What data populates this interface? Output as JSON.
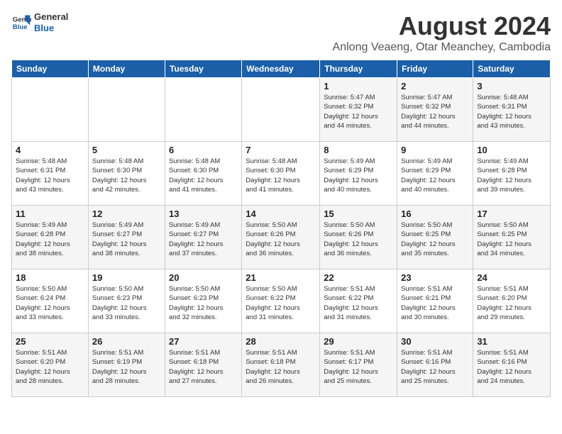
{
  "logo": {
    "line1": "General",
    "line2": "Blue"
  },
  "title": "August 2024",
  "subtitle": "Anlong Veaeng, Otar Meanchey, Cambodia",
  "headers": [
    "Sunday",
    "Monday",
    "Tuesday",
    "Wednesday",
    "Thursday",
    "Friday",
    "Saturday"
  ],
  "weeks": [
    [
      {
        "day": "",
        "info": ""
      },
      {
        "day": "",
        "info": ""
      },
      {
        "day": "",
        "info": ""
      },
      {
        "day": "",
        "info": ""
      },
      {
        "day": "1",
        "info": "Sunrise: 5:47 AM\nSunset: 6:32 PM\nDaylight: 12 hours\nand 44 minutes."
      },
      {
        "day": "2",
        "info": "Sunrise: 5:47 AM\nSunset: 6:32 PM\nDaylight: 12 hours\nand 44 minutes."
      },
      {
        "day": "3",
        "info": "Sunrise: 5:48 AM\nSunset: 6:31 PM\nDaylight: 12 hours\nand 43 minutes."
      }
    ],
    [
      {
        "day": "4",
        "info": "Sunrise: 5:48 AM\nSunset: 6:31 PM\nDaylight: 12 hours\nand 43 minutes."
      },
      {
        "day": "5",
        "info": "Sunrise: 5:48 AM\nSunset: 6:30 PM\nDaylight: 12 hours\nand 42 minutes."
      },
      {
        "day": "6",
        "info": "Sunrise: 5:48 AM\nSunset: 6:30 PM\nDaylight: 12 hours\nand 41 minutes."
      },
      {
        "day": "7",
        "info": "Sunrise: 5:48 AM\nSunset: 6:30 PM\nDaylight: 12 hours\nand 41 minutes."
      },
      {
        "day": "8",
        "info": "Sunrise: 5:49 AM\nSunset: 6:29 PM\nDaylight: 12 hours\nand 40 minutes."
      },
      {
        "day": "9",
        "info": "Sunrise: 5:49 AM\nSunset: 6:29 PM\nDaylight: 12 hours\nand 40 minutes."
      },
      {
        "day": "10",
        "info": "Sunrise: 5:49 AM\nSunset: 6:28 PM\nDaylight: 12 hours\nand 39 minutes."
      }
    ],
    [
      {
        "day": "11",
        "info": "Sunrise: 5:49 AM\nSunset: 6:28 PM\nDaylight: 12 hours\nand 38 minutes."
      },
      {
        "day": "12",
        "info": "Sunrise: 5:49 AM\nSunset: 6:27 PM\nDaylight: 12 hours\nand 38 minutes."
      },
      {
        "day": "13",
        "info": "Sunrise: 5:49 AM\nSunset: 6:27 PM\nDaylight: 12 hours\nand 37 minutes."
      },
      {
        "day": "14",
        "info": "Sunrise: 5:50 AM\nSunset: 6:26 PM\nDaylight: 12 hours\nand 36 minutes."
      },
      {
        "day": "15",
        "info": "Sunrise: 5:50 AM\nSunset: 6:26 PM\nDaylight: 12 hours\nand 36 minutes."
      },
      {
        "day": "16",
        "info": "Sunrise: 5:50 AM\nSunset: 6:25 PM\nDaylight: 12 hours\nand 35 minutes."
      },
      {
        "day": "17",
        "info": "Sunrise: 5:50 AM\nSunset: 6:25 PM\nDaylight: 12 hours\nand 34 minutes."
      }
    ],
    [
      {
        "day": "18",
        "info": "Sunrise: 5:50 AM\nSunset: 6:24 PM\nDaylight: 12 hours\nand 33 minutes."
      },
      {
        "day": "19",
        "info": "Sunrise: 5:50 AM\nSunset: 6:23 PM\nDaylight: 12 hours\nand 33 minutes."
      },
      {
        "day": "20",
        "info": "Sunrise: 5:50 AM\nSunset: 6:23 PM\nDaylight: 12 hours\nand 32 minutes."
      },
      {
        "day": "21",
        "info": "Sunrise: 5:50 AM\nSunset: 6:22 PM\nDaylight: 12 hours\nand 31 minutes."
      },
      {
        "day": "22",
        "info": "Sunrise: 5:51 AM\nSunset: 6:22 PM\nDaylight: 12 hours\nand 31 minutes."
      },
      {
        "day": "23",
        "info": "Sunrise: 5:51 AM\nSunset: 6:21 PM\nDaylight: 12 hours\nand 30 minutes."
      },
      {
        "day": "24",
        "info": "Sunrise: 5:51 AM\nSunset: 6:20 PM\nDaylight: 12 hours\nand 29 minutes."
      }
    ],
    [
      {
        "day": "25",
        "info": "Sunrise: 5:51 AM\nSunset: 6:20 PM\nDaylight: 12 hours\nand 28 minutes."
      },
      {
        "day": "26",
        "info": "Sunrise: 5:51 AM\nSunset: 6:19 PM\nDaylight: 12 hours\nand 28 minutes."
      },
      {
        "day": "27",
        "info": "Sunrise: 5:51 AM\nSunset: 6:18 PM\nDaylight: 12 hours\nand 27 minutes."
      },
      {
        "day": "28",
        "info": "Sunrise: 5:51 AM\nSunset: 6:18 PM\nDaylight: 12 hours\nand 26 minutes."
      },
      {
        "day": "29",
        "info": "Sunrise: 5:51 AM\nSunset: 6:17 PM\nDaylight: 12 hours\nand 25 minutes."
      },
      {
        "day": "30",
        "info": "Sunrise: 5:51 AM\nSunset: 6:16 PM\nDaylight: 12 hours\nand 25 minutes."
      },
      {
        "day": "31",
        "info": "Sunrise: 5:51 AM\nSunset: 6:16 PM\nDaylight: 12 hours\nand 24 minutes."
      }
    ]
  ]
}
